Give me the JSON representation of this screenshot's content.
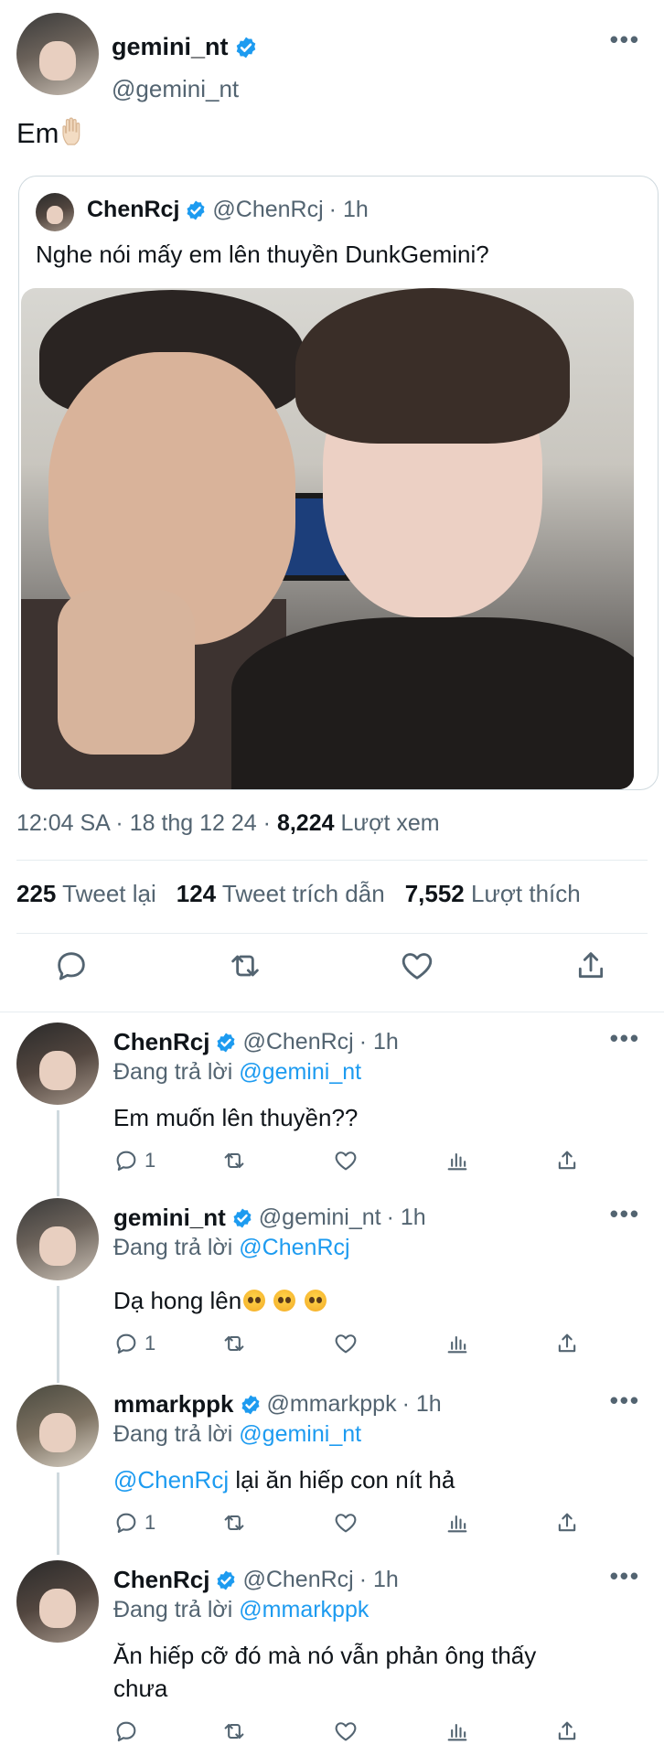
{
  "main_tweet": {
    "display_name": "gemini_nt",
    "handle": "@gemini_nt",
    "more_label": "•••",
    "text": "Em",
    "hand_emoji_icon": "raised-hand-emoji",
    "quoted": {
      "display_name": "ChenRcj",
      "handle": "@ChenRcj",
      "time": "· 1h",
      "text": "Nghe nói mấy em lên thuyền DunkGemini?"
    },
    "meta": {
      "time": "12:04 SA · 18 thg 12 24 ·",
      "views_count": "8,224",
      "views_label": "Lượt xem"
    },
    "stats": {
      "retweets_count": "225",
      "retweets_label": "Tweet lại",
      "quotes_count": "124",
      "quotes_label": "Tweet trích dẫn",
      "likes_count": "7,552",
      "likes_label": "Lượt thích"
    }
  },
  "replies": [
    {
      "display_name": "ChenRcj",
      "handle": "@ChenRcj",
      "time": "· 1h",
      "replying_prefix": "Đang trả lời",
      "replying_to": "@gemini_nt",
      "mention": "",
      "text": "Em muốn lên thuyền??",
      "reply_count": "1"
    },
    {
      "display_name": "gemini_nt",
      "handle": "@gemini_nt",
      "time": "· 1h",
      "replying_prefix": "Đang trả lời",
      "replying_to": "@ChenRcj",
      "mention": "",
      "text": "Dạ hong lên",
      "reply_count": "1"
    },
    {
      "display_name": "mmarkppk",
      "handle": "@mmarkppk",
      "time": "· 1h",
      "replying_prefix": "Đang trả lời",
      "replying_to": "@gemini_nt",
      "mention": "@ChenRcj",
      "text": " lại ăn hiếp con nít hả",
      "reply_count": "1"
    },
    {
      "display_name": "ChenRcj",
      "handle": "@ChenRcj",
      "time": "· 1h",
      "replying_prefix": "Đang trả lời",
      "replying_to": "@mmarkppk",
      "mention": "",
      "text": "Ăn hiếp cỡ đó mà nó vẫn phản ông thấy chưa",
      "reply_count": ""
    }
  ],
  "colors": {
    "accent": "#1d9bf0",
    "secondary_text": "#536471",
    "divider": "#e6ecf0"
  }
}
